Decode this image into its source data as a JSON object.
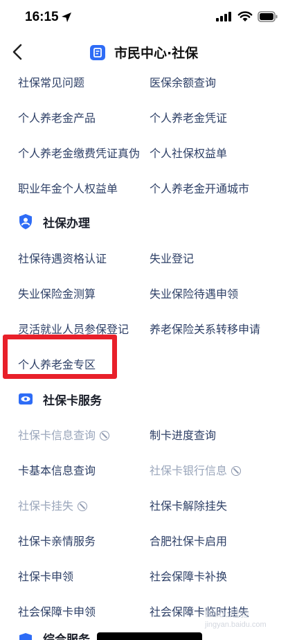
{
  "status_bar": {
    "time": "16:15"
  },
  "nav": {
    "title": "市民中心·社保"
  },
  "inquiry_items": [
    [
      "社保常见问题",
      "医保余额查询"
    ],
    [
      "个人养老金产品",
      "个人养老金凭证"
    ],
    [
      "个人养老金缴费凭证真伪",
      "个人社保权益单"
    ],
    [
      "职业年金个人权益单",
      "个人养老金开通城市"
    ]
  ],
  "section_handle": {
    "title": "社保办理",
    "items": [
      [
        "社保待遇资格认证",
        "失业登记"
      ],
      [
        "失业保险金测算",
        "失业保险待遇申领"
      ],
      [
        "灵活就业人员参保登记",
        "养老保险关系转移申请"
      ],
      [
        "个人养老金专区",
        ""
      ]
    ]
  },
  "section_card": {
    "title": "社保卡服务",
    "items": [
      [
        "社保卡信息查询",
        "制卡进度查询"
      ],
      [
        "卡基本信息查询",
        "社保卡银行信息"
      ],
      [
        "社保卡挂失",
        "社保卡解除挂失"
      ],
      [
        "社保卡亲情服务",
        "合肥社保卡启用"
      ],
      [
        "社保卡申领",
        "社会保障卡补换"
      ],
      [
        "社会保障卡申领",
        "社会保障卡临时挂失"
      ]
    ]
  },
  "section_bottom": {
    "title": "综合服务"
  },
  "watermark": {
    "text": "Baidu经验",
    "sub": "jingyan.baidu.com"
  },
  "colors": {
    "accent": "#2e6cf6",
    "highlight": "#e8202a",
    "link_text": "#2d3f66",
    "disabled_text": "#9aa6bb"
  }
}
